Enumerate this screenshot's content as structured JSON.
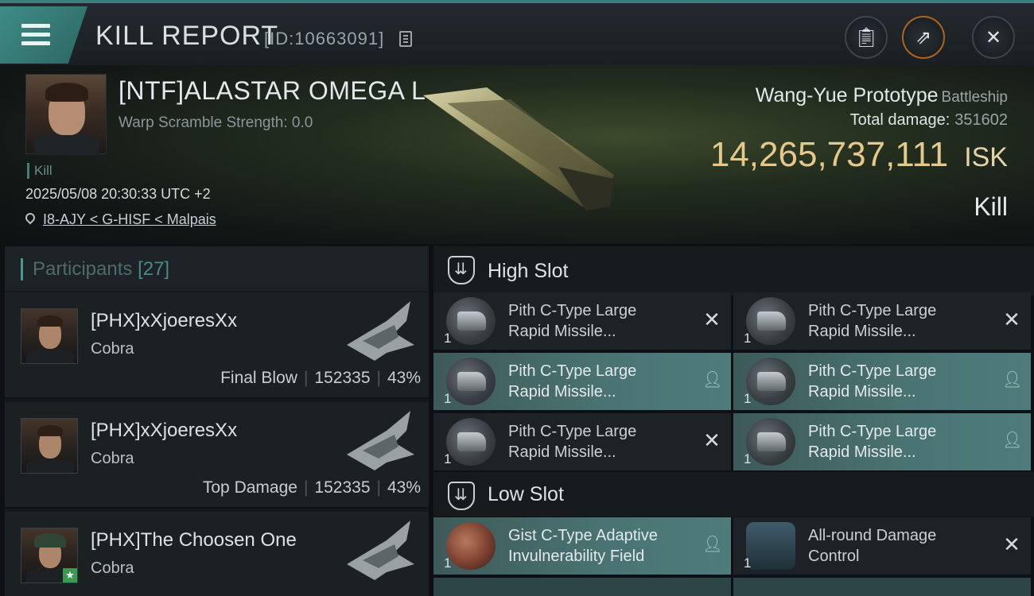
{
  "header": {
    "title": "KILL REPORT",
    "id_text": "[ID:10663091]"
  },
  "hero": {
    "pilot_name": "[NTF]ALASTAR OMEGA L",
    "warp_scramble": "Warp Scramble Strength: 0.0",
    "kill_tag": "Kill",
    "timestamp": "2025/05/08 20:30:33 UTC +2",
    "location": "I8-AJY < G-HISF < Malpais",
    "ship_name": "Wang-Yue Prototype",
    "ship_class": "Battleship",
    "total_damage_label": "Total damage:",
    "total_damage": "351602",
    "isk_value": "14,265,737,111",
    "isk_unit": "ISK",
    "result": "Kill"
  },
  "participants": {
    "label": "Participants",
    "count": "[27]",
    "rows": [
      {
        "name": "[PHX]xXjoeresXx",
        "ship": "Cobra",
        "role": "Final Blow",
        "damage": "152335",
        "percent": "43%"
      },
      {
        "name": "[PHX]xXjoeresXx",
        "ship": "Cobra",
        "role": "Top Damage",
        "damage": "152335",
        "percent": "43%"
      },
      {
        "name": "[PHX]The Choosen One",
        "ship": "Cobra",
        "role": "",
        "damage": "",
        "percent": ""
      }
    ]
  },
  "slots": {
    "high": {
      "label": "High Slot",
      "modules": [
        {
          "qty": "1",
          "name_line1": "Pith C-Type Large",
          "name_line2": "Rapid Missile...",
          "status": "destroyed"
        },
        {
          "qty": "1",
          "name_line1": "Pith C-Type Large",
          "name_line2": "Rapid Missile...",
          "status": "destroyed"
        },
        {
          "qty": "1",
          "name_line1": "Pith C-Type Large",
          "name_line2": "Rapid Missile...",
          "status": "dropped"
        },
        {
          "qty": "1",
          "name_line1": "Pith C-Type Large",
          "name_line2": "Rapid Missile...",
          "status": "dropped"
        },
        {
          "qty": "1",
          "name_line1": "Pith C-Type Large",
          "name_line2": "Rapid Missile...",
          "status": "destroyed"
        },
        {
          "qty": "1",
          "name_line1": "Pith C-Type Large",
          "name_line2": "Rapid Missile...",
          "status": "dropped"
        }
      ]
    },
    "low": {
      "label": "Low Slot",
      "modules": [
        {
          "qty": "1",
          "name_line1": "Gist C-Type Adaptive",
          "name_line2": "Invulnerability Field",
          "status": "dropped"
        },
        {
          "qty": "1",
          "name_line1": "All-round Damage",
          "name_line2": "Control",
          "status": "destroyed"
        }
      ]
    }
  },
  "icons": {
    "menu": "menu-icon",
    "copy": "copy-icon",
    "clipboard": "clipboard-icon",
    "share": "share-icon",
    "close": "close-icon",
    "location": "location-pin-icon",
    "destroyed": "x-icon",
    "dropped": "person-icon"
  },
  "colors": {
    "accent": "#3f8b86",
    "isk": "#e6c98a",
    "active_module": "#4a7473"
  }
}
